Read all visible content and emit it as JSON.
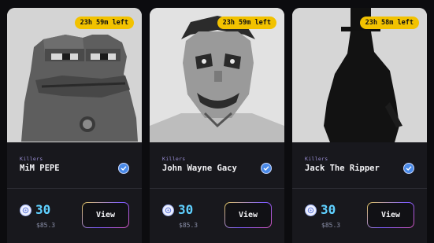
{
  "cards": [
    {
      "timer": "23h 59m left",
      "collection": "Killers",
      "title": "MiM PEPE",
      "price": "30",
      "usd": "$85.3",
      "button": "View"
    },
    {
      "timer": "23h 59m left",
      "collection": "Killers",
      "title": "John Wayne Gacy",
      "price": "30",
      "usd": "$85.3",
      "button": "View"
    },
    {
      "timer": "23h 58m left",
      "collection": "Killers",
      "title": "Jack The Ripper",
      "price": "30",
      "usd": "$85.3",
      "button": "View"
    }
  ],
  "icons": {
    "verified": "verified-check-icon",
    "currency": "currency-token-icon"
  },
  "colors": {
    "accent_price": "#5fd0ff",
    "timer_badge": "#f2c200",
    "verified": "#4a8ae8"
  }
}
